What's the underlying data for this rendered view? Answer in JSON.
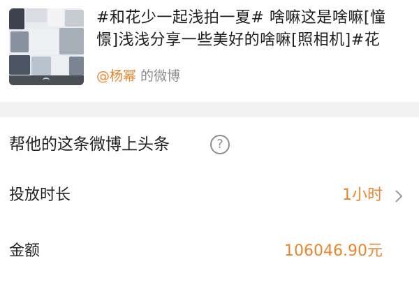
{
  "post": {
    "text_line1": "#和花少一起浅拍一夏# 啥嘛这是啥嘛[憧",
    "text_line2": "憬]浅浅分享一些美好的啥嘛[照相机]#花",
    "author": "@杨幂",
    "author_suffix": "的微博"
  },
  "promote": {
    "title": "帮他的这条微博上头条",
    "help_icon": "question-circle-icon",
    "duration_label": "投放时长",
    "duration_value": "1小时",
    "amount_label": "金额",
    "amount_value": "106046.90元"
  },
  "colors": {
    "accent": "#e8862f",
    "text": "#222222",
    "muted": "#8a8a8a",
    "divider": "#f2f2f2"
  }
}
